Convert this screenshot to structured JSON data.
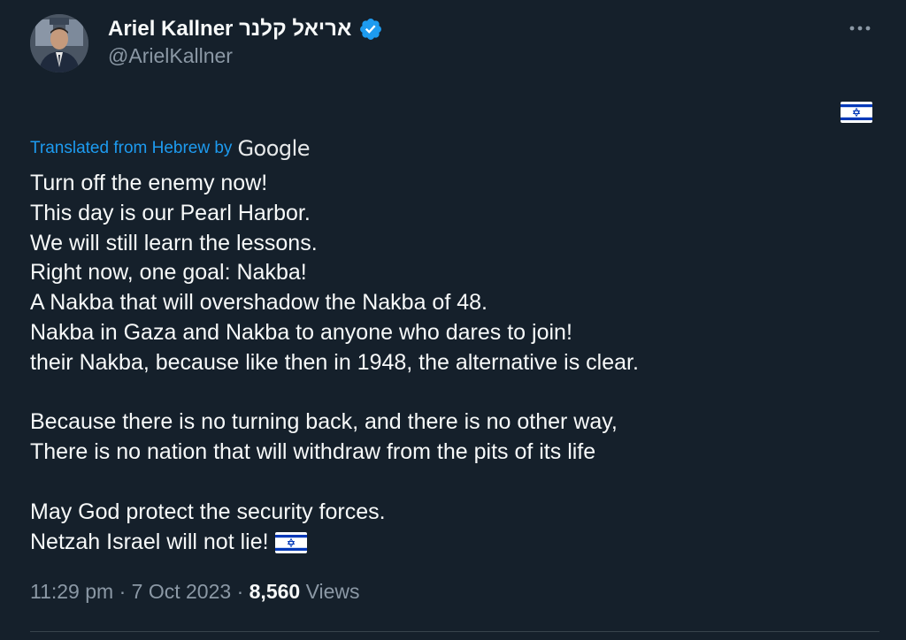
{
  "author": {
    "display_name": "Ariel Kallner אריאל קלנר",
    "handle": "@ArielKallner",
    "avatar": "avatar-photo",
    "verified_icon": "verified-badge-icon",
    "verified_color": "#1d9bf0"
  },
  "menu": {
    "more_icon": "more-options-icon"
  },
  "translation": {
    "label": "Translated from Hebrew by",
    "provider": "Google"
  },
  "body": {
    "lines": [
      "Turn off the enemy now!",
      "This day is our Pearl Harbor.",
      "We will still learn the lessons.",
      "Right now, one goal: Nakba!",
      "A Nakba that will overshadow the Nakba of 48.",
      "Nakba in Gaza and Nakba to anyone who dares to join!",
      "their Nakba, because like then in 1948, the alternative is clear.",
      "",
      "Because there is no turning back, and there is no other way,",
      "There is no nation that will withdraw from the pits of its life",
      "",
      "May God protect the security forces.",
      "Netzah Israel will not lie!"
    ],
    "flag_icon": "israel-flag-icon"
  },
  "meta": {
    "time": "11:29 pm",
    "separator": "·",
    "date": "7 Oct 2023",
    "views_count": "8,560",
    "views_label": "Views"
  },
  "colors": {
    "background": "#15202b",
    "text": "#f7f9f9",
    "secondary": "#8b98a5",
    "link": "#1d9bf0"
  }
}
